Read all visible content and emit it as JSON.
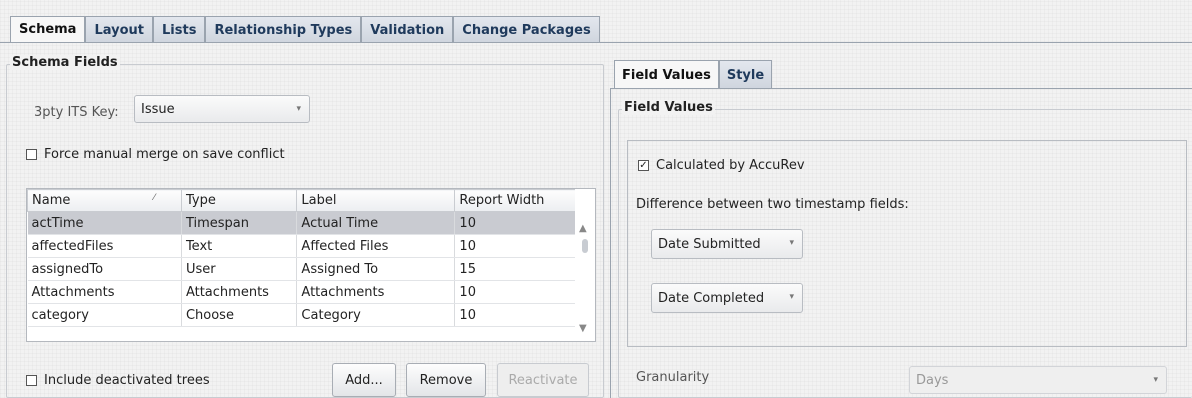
{
  "top_tabs": [
    "Schema",
    "Layout",
    "Lists",
    "Relationship Types",
    "Validation",
    "Change Packages"
  ],
  "schema_fields": {
    "legend": "Schema Fields",
    "its_key_label": "3pty ITS Key:",
    "its_key_value": "Issue",
    "force_merge_label": "Force manual merge on save conflict",
    "table": {
      "headers": [
        "Name",
        "Type",
        "Label",
        "Report Width"
      ],
      "rows": [
        [
          "actTime",
          "Timespan",
          "Actual Time",
          "10"
        ],
        [
          "affectedFiles",
          "Text",
          "Affected Files",
          "10"
        ],
        [
          "assignedTo",
          "User",
          "Assigned To",
          "15"
        ],
        [
          "Attachments",
          "Attachments",
          "Attachments",
          "10"
        ],
        [
          "category",
          "Choose",
          "Category",
          "10"
        ]
      ],
      "selected_row": 0
    },
    "include_deactivated_label": "Include deactivated trees",
    "add_label": "Add...",
    "remove_label": "Remove",
    "reactivate_label": "Reactivate"
  },
  "right": {
    "tabs": [
      "Field Values",
      "Style"
    ],
    "legend": "Field Values",
    "calculated_label": "Calculated by AccuRev",
    "difference_label": "Difference between two timestamp fields:",
    "field1": "Date Submitted",
    "field2": "Date Completed",
    "granularity_label": "Granularity",
    "granularity_value": "Days"
  }
}
